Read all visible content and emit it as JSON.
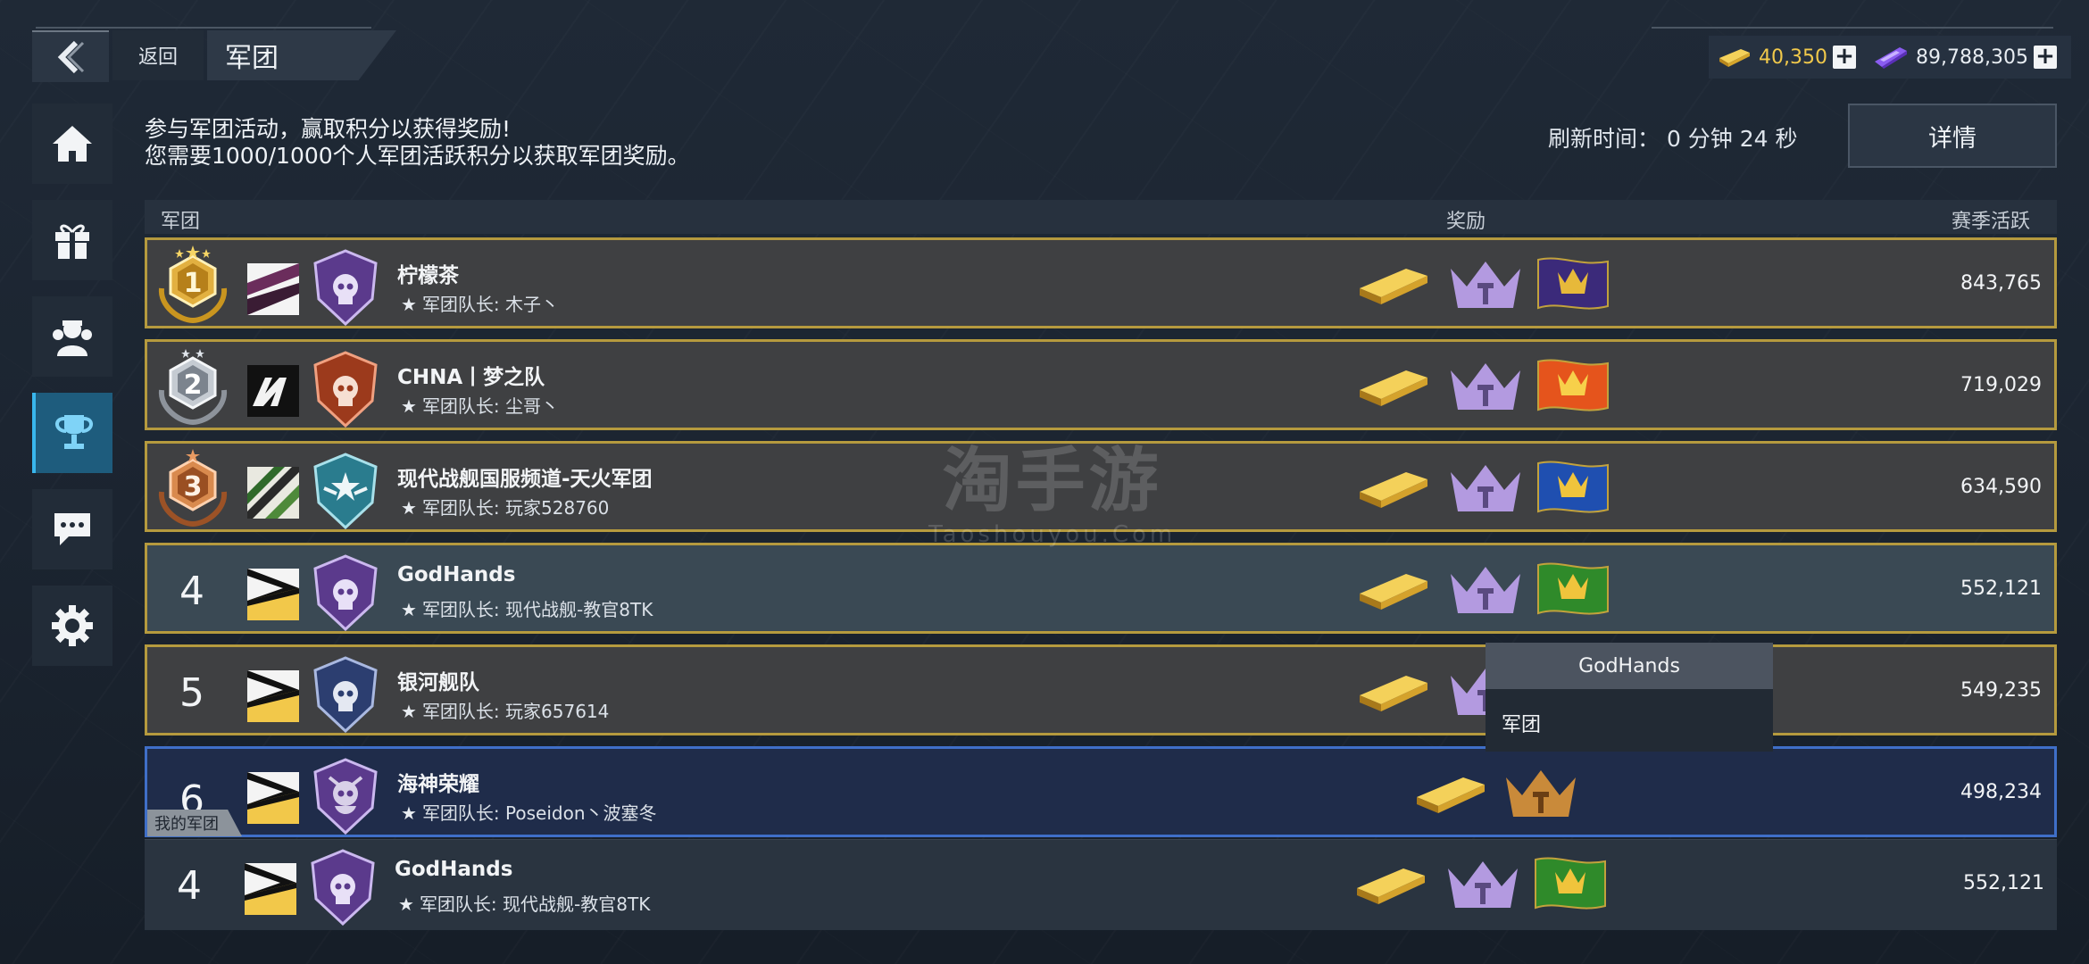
{
  "header": {
    "back_label": "返回",
    "title": "军团"
  },
  "currency": {
    "gold": "40,350",
    "premium": "89,788,305"
  },
  "sidebar": {
    "items": [
      {
        "icon": "home-icon"
      },
      {
        "icon": "gift-icon"
      },
      {
        "icon": "clan-icon"
      },
      {
        "icon": "trophy-icon",
        "active": true
      },
      {
        "icon": "chat-icon"
      },
      {
        "icon": "gear-icon"
      }
    ]
  },
  "info": {
    "line1": "参与军团活动，赢取积分以获得奖励!",
    "line2": "您需要1000/1000个人军团活跃积分以获取军团奖励。"
  },
  "refresh": {
    "text": "刷新时间：  0 分钟 24 秒"
  },
  "details_label": "详情",
  "table": {
    "col_clan": "军团",
    "col_reward": "奖励",
    "col_season": "赛季活跃",
    "rows": [
      {
        "rank": "1",
        "name": "柠檬茶",
        "leader": "军团队长: 木子丶",
        "score": "843,765"
      },
      {
        "rank": "2",
        "name": "CHNA丨梦之队",
        "leader": "军团队长: 尘哥丶",
        "score": "719,029"
      },
      {
        "rank": "3",
        "name": "现代战舰国服频道-天火军团",
        "leader": "军团队长: 玩家528760",
        "score": "634,590"
      },
      {
        "rank": "4",
        "name": "GodHands",
        "leader": "军团队长: 现代战舰-教官8TK",
        "score": "552,121"
      },
      {
        "rank": "5",
        "name": "银河舰队",
        "leader": "军团队长: 玩家657614",
        "score": "549,235"
      },
      {
        "rank": "6",
        "name": "海神荣耀",
        "leader": "军团队长: Poseidon丶波塞冬",
        "score": "498,234"
      },
      {
        "rank": "4",
        "name": "GodHands",
        "leader": "军团队长: 现代战舰-教官8TK",
        "score": "552,121"
      }
    ]
  },
  "my_clan_tag": "我的军团",
  "popup": {
    "title": "GodHands",
    "item": "军团"
  },
  "watermark": {
    "cn": "淘手游",
    "en": "Taoshouyou.Com"
  },
  "colors": {
    "gold_border": "#b59a3e",
    "active_blue": "#39b6ec",
    "mine_border": "#3f6fc8"
  }
}
